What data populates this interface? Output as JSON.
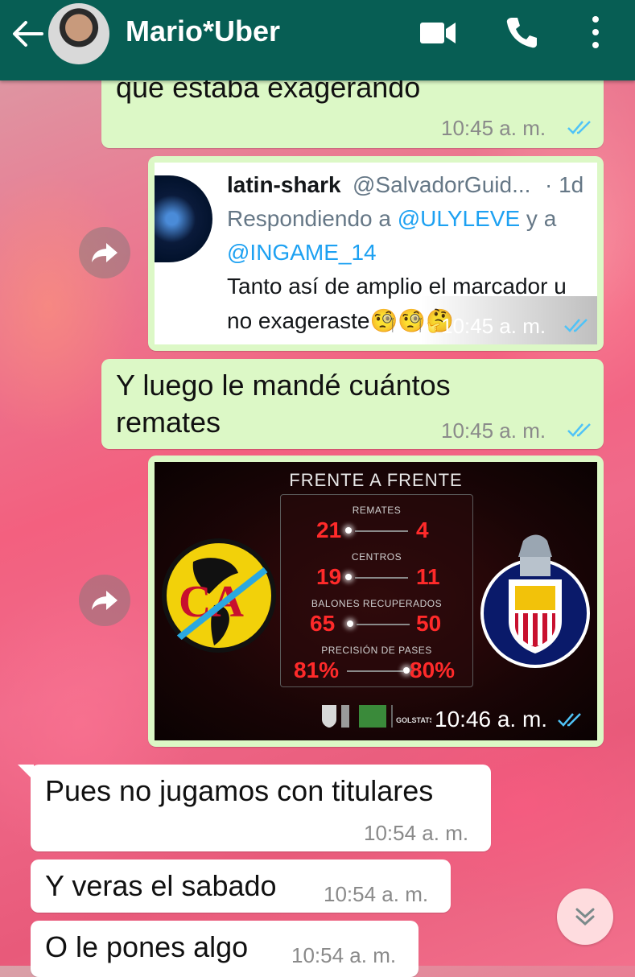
{
  "header": {
    "contact_name": "Mario*Uber",
    "colors": {
      "bar": "#075e54"
    },
    "icons": [
      "back-arrow-icon",
      "video-call-icon",
      "phone-icon",
      "more-vert-icon"
    ]
  },
  "messages": [
    {
      "direction": "outgoing",
      "text_lines": [
        "que estaba exagerando"
      ],
      "time": "10:45 a. m.",
      "read": true
    },
    {
      "direction": "outgoing",
      "type": "tweet-screenshot",
      "time": "10:45 a. m.",
      "read": true,
      "tweet": {
        "name": "latin-shark",
        "handle": "@SalvadorGuid...",
        "age": "· 1d",
        "reply_prefix": "Respondiendo a ",
        "reply_mention1": "@ULYLEVE",
        "reply_joiner": " y a",
        "reply_mention2": "@INGAME_14",
        "body_line1": "Tanto así de amplio el marcador u",
        "body_line2": "no exageraste🧐🧐🤔"
      }
    },
    {
      "direction": "outgoing",
      "text_lines": [
        "Y luego le mandé cuántos",
        "remates"
      ],
      "time": "10:45 a. m.",
      "read": true
    },
    {
      "direction": "outgoing",
      "type": "image",
      "time": "10:46 a. m.",
      "read": true,
      "image": {
        "title": "FRENTE A FRENTE",
        "stats": [
          {
            "label": "REMATES",
            "left": "21",
            "right": "4"
          },
          {
            "label": "CENTROS",
            "left": "19",
            "right": "11"
          },
          {
            "label": "BALONES RECUPERADOS",
            "left": "65",
            "right": "50"
          },
          {
            "label": "PRECISIÓN DE PASES",
            "left": "81%",
            "right": "80%"
          }
        ],
        "left_logo_letters": "CA",
        "right_logo_text": "CLUB DEPORTIVO GUADALAJARA S.A. DE C.V.",
        "footer_brand": "GOLSTATS"
      }
    },
    {
      "direction": "incoming",
      "text_lines": [
        "Pues no jugamos con titulares"
      ],
      "time": "10:54 a. m."
    },
    {
      "direction": "incoming",
      "text_lines": [
        "Y veras el sabado"
      ],
      "time": "10:54 a. m."
    },
    {
      "direction": "incoming",
      "text_lines": [
        "O le pones algo"
      ],
      "time": "10:54 a. m."
    }
  ],
  "colors": {
    "outgoing_bubble": "#dcf8c6",
    "incoming_bubble": "#ffffff",
    "read_ticks": "#4fc3f7"
  }
}
